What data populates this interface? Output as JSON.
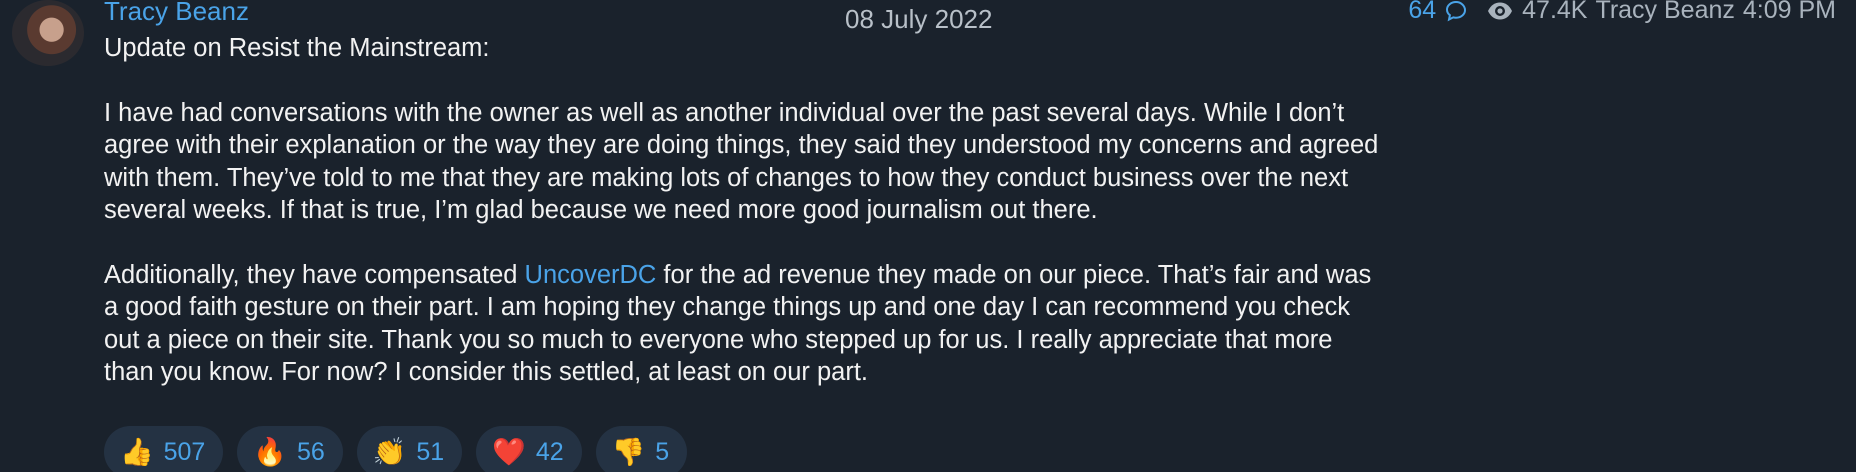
{
  "message": {
    "sender": "Tracy Beanz",
    "date_chip": "08 July 2022",
    "title_line": "Update on Resist the Mainstream:",
    "para1": "I have had conversations with the owner as well as another individual over the past several days. While I don’t agree with their explanation or the way they are doing things, they said they understood my concerns and agreed with them. They’ve told to me that they are making lots of changes to how they conduct business over the next several weeks. If that is true, I’m glad because we need more good journalism out there.",
    "para2_before": "Additionally, they have compensated ",
    "para2_link": "UncoverDC",
    "para2_after": " for the ad revenue they made on our piece. That’s fair and was a good faith gesture on their part. I am hoping they change things up and one day I can recommend you check out a piece on their site. Thank you so much to everyone who stepped up for us. I really appreciate that more than you know. For now? I consider this settled, at least on our part."
  },
  "meta": {
    "replies": "64",
    "views": "47.4K",
    "author": "Tracy Beanz",
    "time": "4:09 PM"
  },
  "reactions": [
    {
      "emoji": "👍",
      "count": "507"
    },
    {
      "emoji": "🔥",
      "count": "56"
    },
    {
      "emoji": "👏",
      "count": "51"
    },
    {
      "emoji": "❤️",
      "count": "42"
    },
    {
      "emoji": "👎",
      "count": "5"
    }
  ],
  "colors": {
    "background": "#1a222c",
    "accent": "#4aa3e8",
    "reaction_bg": "#243243"
  }
}
